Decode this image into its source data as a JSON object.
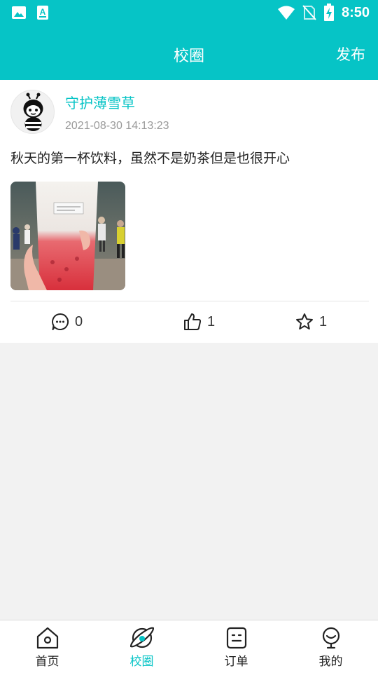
{
  "status_bar": {
    "time": "8:50",
    "icons_left": [
      "image-icon",
      "text-a-icon"
    ],
    "icons_right": [
      "wifi-icon",
      "no-sim-icon",
      "battery-charging-icon"
    ]
  },
  "app_bar": {
    "title": "校圈",
    "action_label": "发布"
  },
  "post": {
    "username": "守护薄雪草",
    "timestamp": "2021-08-30 14:13:23",
    "content": "秋天的第一杯饮料，虽然不是奶茶但是也很开心",
    "comment_count": "0",
    "like_count": "1",
    "favorite_count": "1"
  },
  "tabs": [
    {
      "label": "首页",
      "icon": "home-icon",
      "active": false
    },
    {
      "label": "校圈",
      "icon": "planet-icon",
      "active": true
    },
    {
      "label": "订单",
      "icon": "order-icon",
      "active": false
    },
    {
      "label": "我的",
      "icon": "profile-icon",
      "active": false
    }
  ],
  "colors": {
    "accent": "#06c4c6",
    "background": "#f2f2f2",
    "card": "#ffffff",
    "muted_text": "#9a9a9a"
  }
}
